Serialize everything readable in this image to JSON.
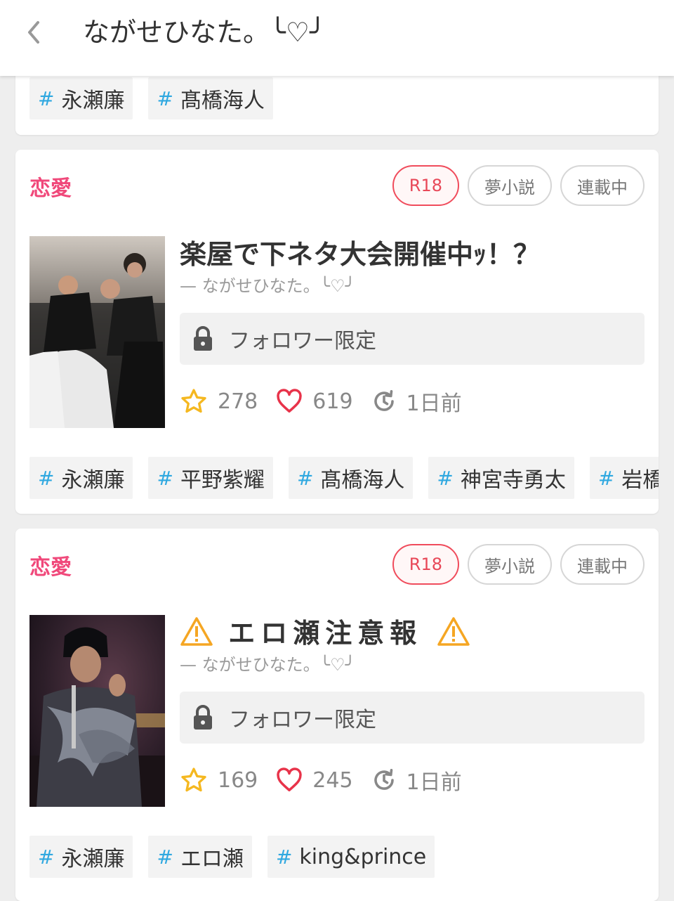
{
  "header": {
    "title": "ながせひなた。╰♡╯"
  },
  "top_card": {
    "tags": [
      "永瀬廉",
      "髙橋海人"
    ]
  },
  "works": [
    {
      "genre": "恋愛",
      "badges": [
        "R18",
        "夢小説",
        "連載中"
      ],
      "title": "楽屋で下ネタ大会開催中ｯ！？",
      "author": "— ながせひなた。╰♡╯",
      "lock_text": "フォロワー限定",
      "stars": "278",
      "hearts": "619",
      "updated": "1日前",
      "tags": [
        "永瀬廉",
        "平野紫耀",
        "髙橋海人",
        "神宮寺勇太",
        "岩橋"
      ]
    },
    {
      "genre": "恋愛",
      "badges": [
        "R18",
        "夢小説",
        "連載中"
      ],
      "title": "エロ瀬注意報",
      "author": "— ながせひなた。╰♡╯",
      "lock_text": "フォロワー限定",
      "stars": "169",
      "hearts": "245",
      "updated": "1日前",
      "tags": [
        "永瀬廉",
        "エロ瀬",
        "king&prince"
      ]
    }
  ],
  "colors": {
    "accent_pink": "#f0487a",
    "r18_red": "#f04c5c",
    "hashtag_blue": "#2fa8e0",
    "star_yellow": "#f5b820",
    "heart_red": "#e8334a"
  }
}
